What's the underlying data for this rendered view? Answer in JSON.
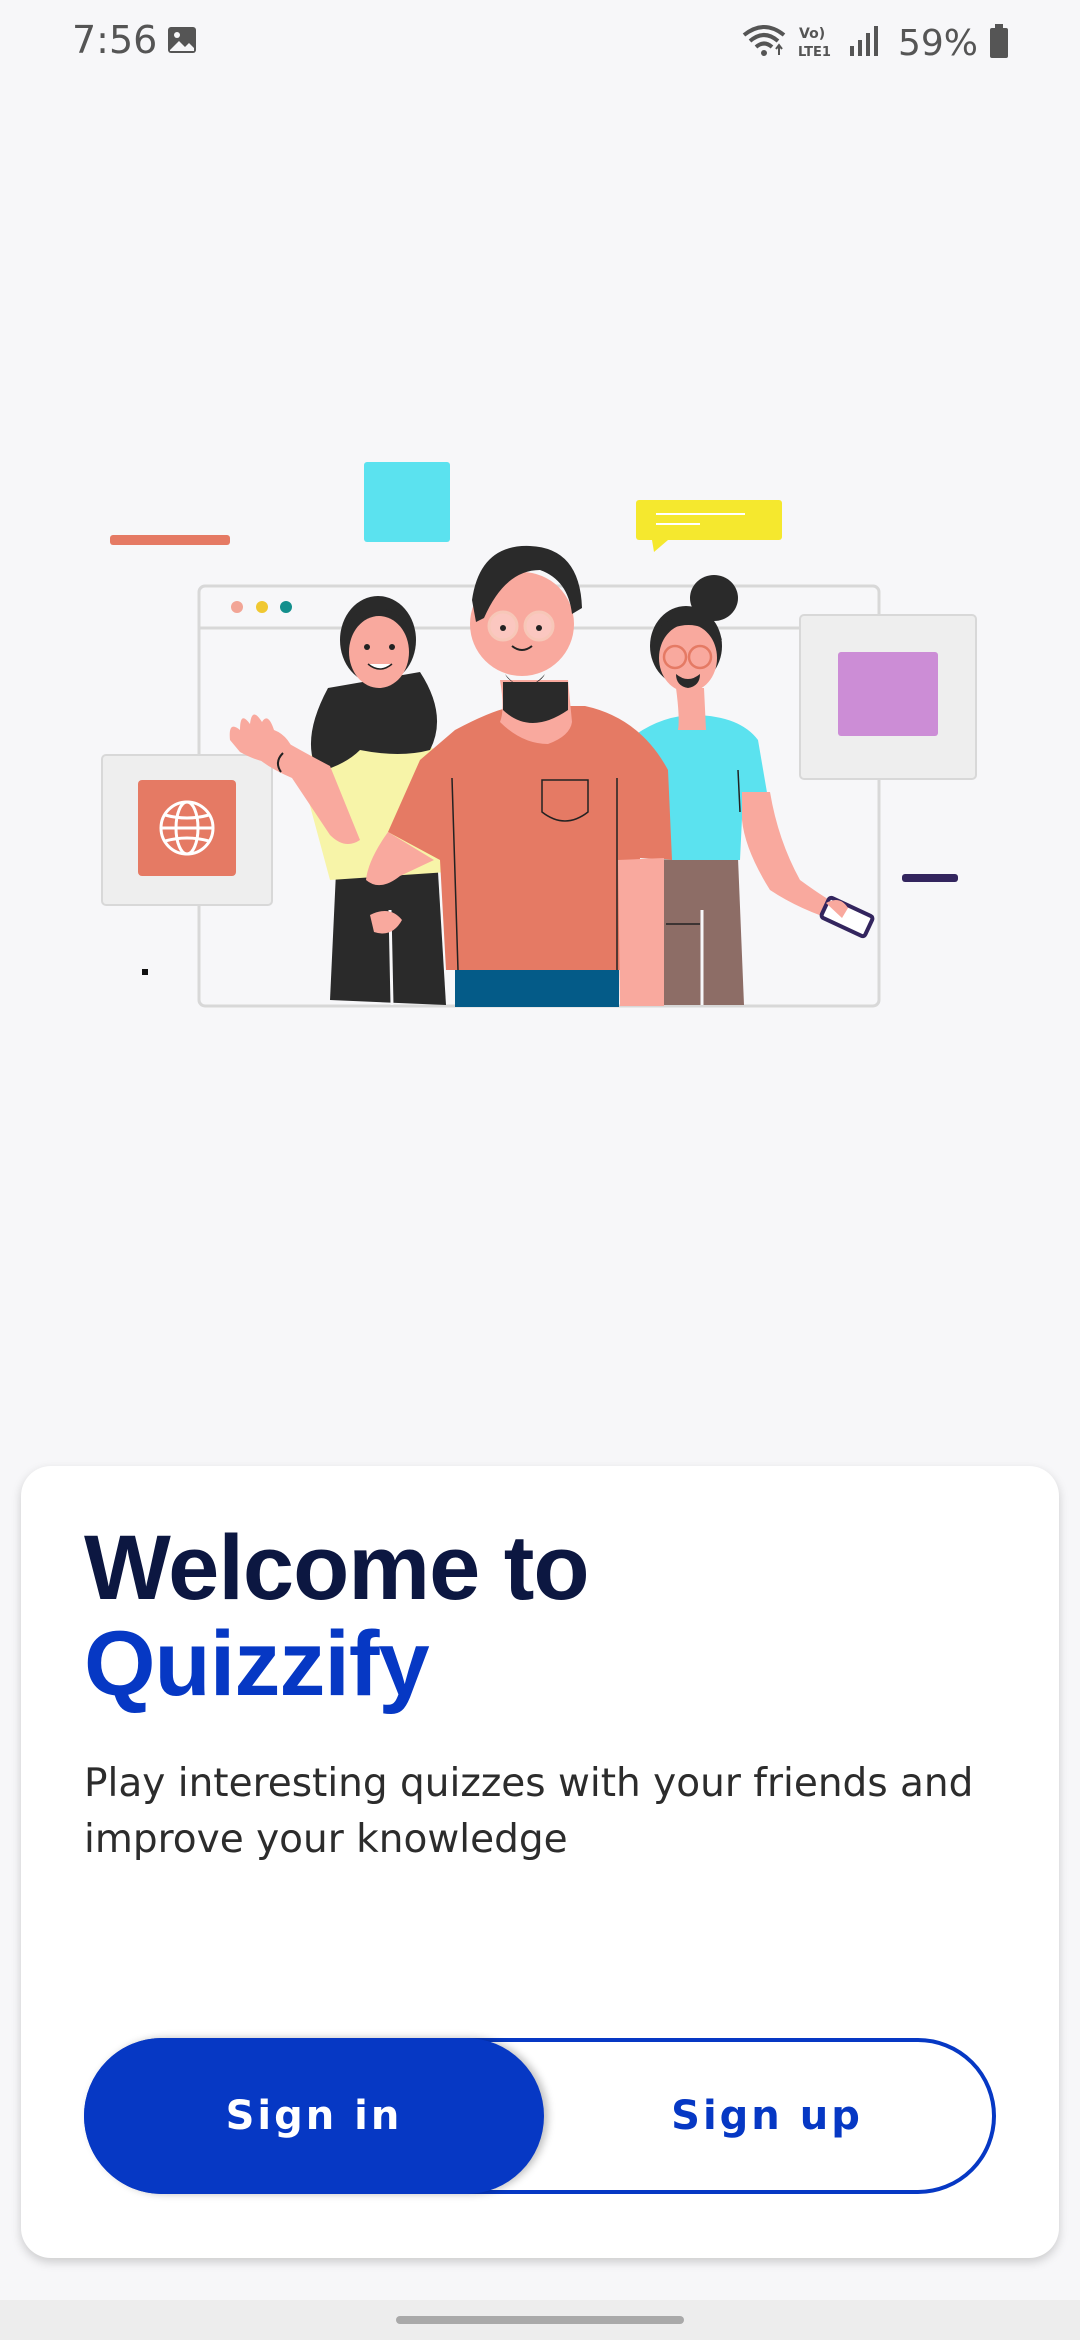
{
  "status_bar": {
    "time": "7:56",
    "network_label": "Vo) LTE1",
    "battery_percent": "59%",
    "icons": [
      "gallery-icon",
      "wifi-icon",
      "volte-icon",
      "signal-icon",
      "battery-icon"
    ]
  },
  "illustration": {
    "icons": [
      "globe-icon"
    ],
    "colors": {
      "coral": "#e57a64",
      "cyan": "#5be2ef",
      "yellow": "#f5e82e",
      "purple": "#cc8dd6",
      "navy": "#33255e"
    }
  },
  "welcome": {
    "title_line1": "Welcome to",
    "title_line2": "Quizzify",
    "subtitle": "Play interesting quizzes with your friends and improve your knowledge"
  },
  "auth": {
    "sign_in_label": "Sign in",
    "sign_up_label": "Sign up",
    "selected": "Sign in"
  },
  "colors": {
    "brand": "#0638c4",
    "title_dark": "#0c1741",
    "background": "#f7f7f9"
  }
}
